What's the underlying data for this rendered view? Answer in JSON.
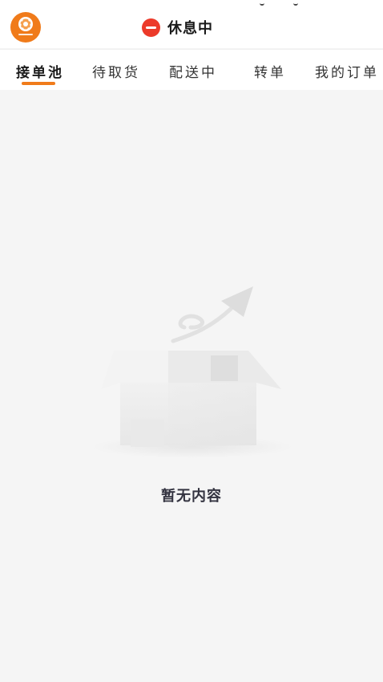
{
  "header": {
    "status_text": "休息中",
    "status_icon": "minus-circle-icon",
    "logo_icon": "brand-logo"
  },
  "tabs": [
    {
      "label": "接单池",
      "active": true
    },
    {
      "label": "待取货",
      "active": false
    },
    {
      "label": "配送中",
      "active": false
    },
    {
      "label": "转单",
      "active": false
    },
    {
      "label": "我的订单",
      "active": false
    }
  ],
  "empty_state": {
    "message": "暂无内容",
    "illustration": "empty-box-illustration"
  },
  "colors": {
    "accent": "#f07b1a",
    "status_red": "#ec3a2a",
    "background": "#f5f5f5"
  }
}
